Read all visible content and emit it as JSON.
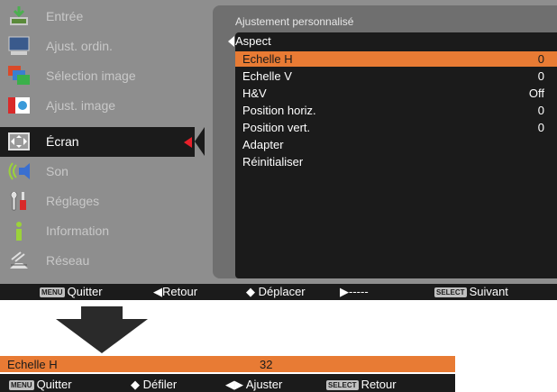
{
  "sidebar": {
    "items": [
      {
        "label": "Entrée",
        "icon": "input-icon"
      },
      {
        "label": "Ajust. ordin.",
        "icon": "computer-icon"
      },
      {
        "label": "Sélection image",
        "icon": "image-select-icon"
      },
      {
        "label": "Ajust. image",
        "icon": "image-adjust-icon"
      },
      {
        "label": "Écran",
        "icon": "screen-icon",
        "selected": true
      },
      {
        "label": "Son",
        "icon": "sound-icon"
      },
      {
        "label": "Réglages",
        "icon": "settings-icon"
      },
      {
        "label": "Information",
        "icon": "info-icon"
      },
      {
        "label": "Réseau",
        "icon": "network-icon"
      }
    ]
  },
  "submenu": {
    "title": "Ajustement personnalisé",
    "aspect": "Aspect",
    "rows": [
      {
        "label": "Echelle H",
        "value": "0",
        "highlight": true
      },
      {
        "label": "Echelle V",
        "value": "0"
      },
      {
        "label": "H&V",
        "value": "Off"
      },
      {
        "label": "Position horiz.",
        "value": "0"
      },
      {
        "label": "Position vert.",
        "value": "0"
      },
      {
        "label": "Adapter",
        "value": ""
      },
      {
        "label": "Réinitialiser",
        "value": ""
      }
    ]
  },
  "statusbar": {
    "menu_key": "MENU",
    "quit": "Quitter",
    "back": "◀Retour",
    "move": "◆ Déplacer",
    "next_arrow": "▶-----",
    "select_key": "SELECT",
    "next": "Suivant"
  },
  "adjust": {
    "label": "Echelle H",
    "value": "32",
    "menu_key": "MENU",
    "quit": "Quitter",
    "scroll": "◆ Défiler",
    "adjust": "◀▶ Ajuster",
    "select_key": "SELECT",
    "back": "Retour"
  },
  "colors": {
    "highlight": "#e87b34",
    "selected_arrow": "#e8202a",
    "panel": "#8e8e8e",
    "dark": "#1b1b1b"
  }
}
